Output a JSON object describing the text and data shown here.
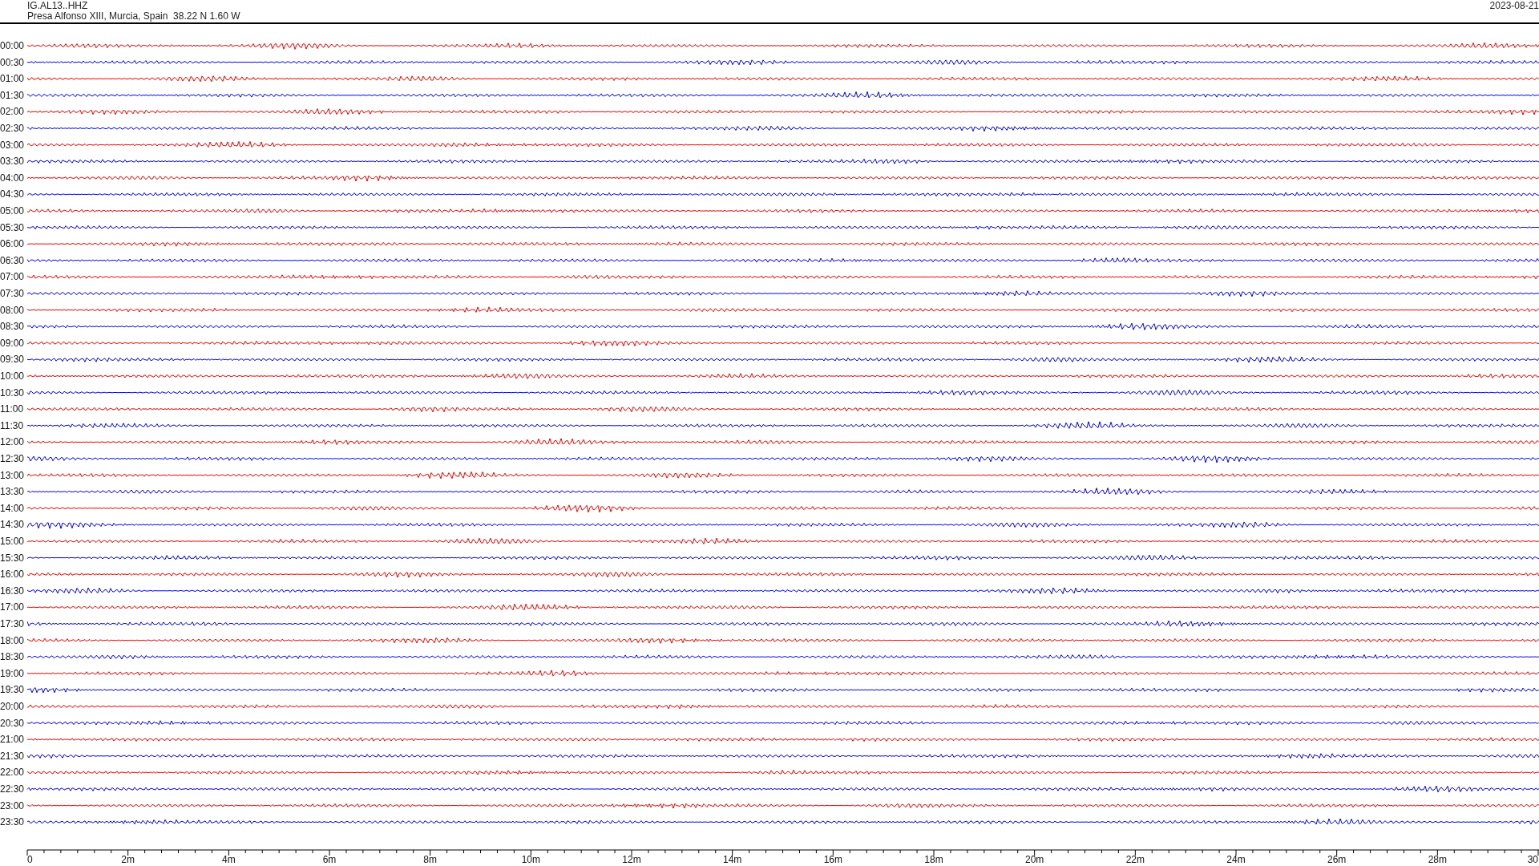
{
  "header": {
    "station": "IG.AL13..HHZ",
    "location": "Presa Alfonso XIII, Murcia, Spain  38.22 N 1.60 W",
    "date": "2023-08-21"
  },
  "rows": [
    {
      "time": "00:00",
      "color": "#ff0000"
    },
    {
      "time": "00:30",
      "color": "#0000ff"
    },
    {
      "time": "01:00",
      "color": "#ff0000"
    },
    {
      "time": "01:30",
      "color": "#0000ff"
    },
    {
      "time": "02:00",
      "color": "#ff0000"
    },
    {
      "time": "02:30",
      "color": "#0000ff"
    },
    {
      "time": "03:00",
      "color": "#ff0000"
    },
    {
      "time": "03:30",
      "color": "#0000ff"
    },
    {
      "time": "04:00",
      "color": "#ff0000"
    },
    {
      "time": "04:30",
      "color": "#0000ff"
    },
    {
      "time": "05:00",
      "color": "#ff0000"
    },
    {
      "time": "05:30",
      "color": "#0000ff"
    },
    {
      "time": "06:00",
      "color": "#ff0000"
    },
    {
      "time": "06:30",
      "color": "#0000ff"
    },
    {
      "time": "07:00",
      "color": "#ff0000"
    },
    {
      "time": "07:30",
      "color": "#0000ff"
    },
    {
      "time": "08:00",
      "color": "#ff0000"
    },
    {
      "time": "08:30",
      "color": "#0000ff"
    },
    {
      "time": "09:00",
      "color": "#ff0000"
    },
    {
      "time": "09:30",
      "color": "#0000ff"
    },
    {
      "time": "10:00",
      "color": "#ff0000"
    },
    {
      "time": "10:30",
      "color": "#0000ff"
    },
    {
      "time": "11:00",
      "color": "#ff0000"
    },
    {
      "time": "11:30",
      "color": "#0000ff"
    },
    {
      "time": "12:00",
      "color": "#ff0000"
    },
    {
      "time": "12:30",
      "color": "#0000ff"
    },
    {
      "time": "13:00",
      "color": "#ff0000"
    },
    {
      "time": "13:30",
      "color": "#0000ff"
    },
    {
      "time": "14:00",
      "color": "#ff0000"
    },
    {
      "time": "14:30",
      "color": "#0000ff"
    },
    {
      "time": "15:00",
      "color": "#ff0000"
    },
    {
      "time": "15:30",
      "color": "#0000ff"
    },
    {
      "time": "16:00",
      "color": "#ff0000"
    },
    {
      "time": "16:30",
      "color": "#0000ff"
    },
    {
      "time": "17:00",
      "color": "#ff0000"
    },
    {
      "time": "17:30",
      "color": "#0000ff"
    },
    {
      "time": "18:00",
      "color": "#ff0000"
    },
    {
      "time": "18:30",
      "color": "#0000ff"
    },
    {
      "time": "19:00",
      "color": "#ff0000"
    },
    {
      "time": "19:30",
      "color": "#0000ff"
    },
    {
      "time": "20:00",
      "color": "#ff0000"
    },
    {
      "time": "20:30",
      "color": "#0000ff"
    },
    {
      "time": "21:00",
      "color": "#ff0000"
    },
    {
      "time": "21:30",
      "color": "#0000ff"
    },
    {
      "time": "22:00",
      "color": "#ff0000"
    },
    {
      "time": "22:30",
      "color": "#0000ff"
    },
    {
      "time": "23:00",
      "color": "#ff0000"
    },
    {
      "time": "23:30",
      "color": "#0000ff"
    }
  ],
  "x_axis": {
    "labels": [
      "0",
      "2m",
      "4m",
      "6m",
      "8m",
      "10m",
      "12m",
      "14m",
      "16m",
      "18m",
      "20m",
      "22m",
      "24m",
      "26m",
      "28m",
      "30"
    ]
  }
}
